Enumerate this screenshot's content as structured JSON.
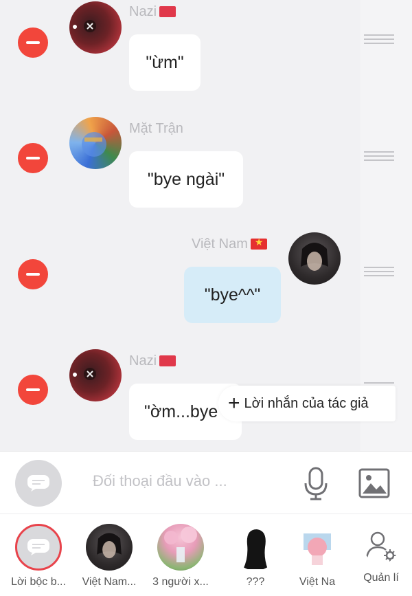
{
  "messages": [
    {
      "sender": "Nazi",
      "flag": "red",
      "text": "\"ừm\"",
      "side": "left"
    },
    {
      "sender": "Mặt Trận",
      "flag": "",
      "text": "\"bye ngài\"",
      "side": "left"
    },
    {
      "sender": "Việt Nam",
      "flag": "vn",
      "text": "\"bye^^\"",
      "side": "right"
    },
    {
      "sender": "Nazi",
      "flag": "red",
      "text": "\"ờm...bye",
      "side": "left"
    }
  ],
  "tooltip": {
    "plus": "+",
    "label": "Lời nhắn của tác giả"
  },
  "input": {
    "placeholder": "Đối thoại đầu vào ..."
  },
  "tabs": [
    {
      "label": "Lời bộc b..."
    },
    {
      "label": "Việt Nam..."
    },
    {
      "label": "3 người x..."
    },
    {
      "label": "???"
    },
    {
      "label": "Việt Na"
    },
    {
      "label": "Quản lí"
    }
  ],
  "colors": {
    "delete": "#f2463b",
    "my_bubble": "#d6ecf8",
    "active_ring": "#e8434b"
  }
}
